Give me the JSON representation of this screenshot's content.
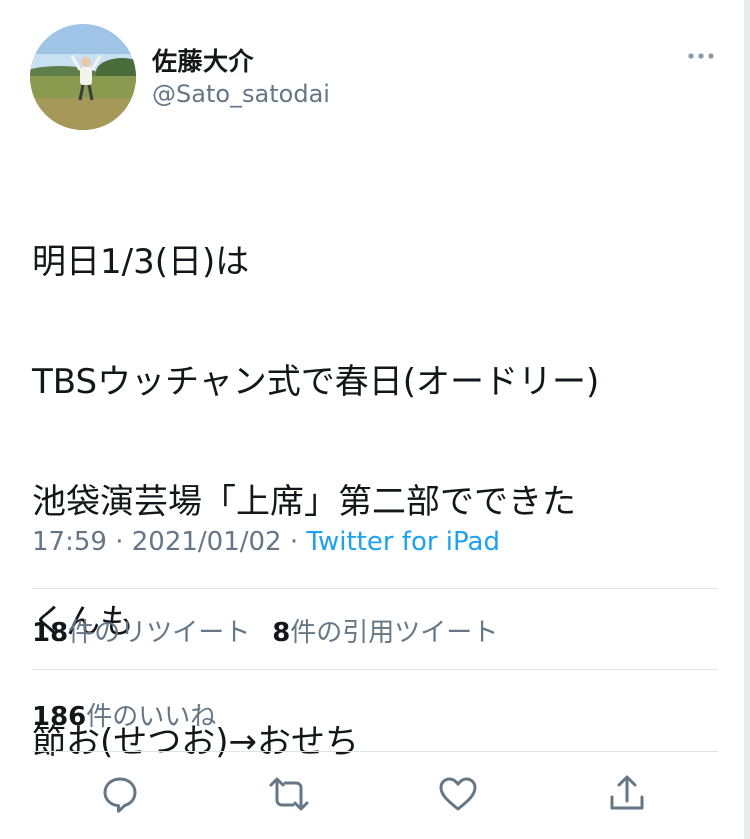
{
  "user": {
    "display_name": "佐藤大介",
    "handle": "@Sato_satodai",
    "avatar_icon": "user-avatar-photo"
  },
  "tweet": {
    "lines": [
      "明日1/3(日)は",
      "TBSウッチャン式で春日(オードリー)",
      "池袋演芸場「上席」第二部でできた",
      "くんも",
      "節お(せつお)→おせち"
    ]
  },
  "meta": {
    "time": "17:59",
    "separator": "·",
    "date": "2021/01/02",
    "source": "Twitter for iPad"
  },
  "stats": {
    "retweets_count": "18",
    "retweets_label": "件のリツイート",
    "quotes_count": "8",
    "quotes_label": "件の引用ツイート",
    "likes_count": "186",
    "likes_label": "件のいいね"
  },
  "actions": [
    {
      "name": "reply",
      "icon": "reply-icon"
    },
    {
      "name": "retweet",
      "icon": "retweet-icon"
    },
    {
      "name": "like",
      "icon": "like-icon"
    },
    {
      "name": "share",
      "icon": "share-icon"
    }
  ],
  "colors": {
    "accent": "#1da1f2",
    "secondary_text": "#657786",
    "primary_text": "#14171a",
    "divider": "#dfe3e7"
  }
}
